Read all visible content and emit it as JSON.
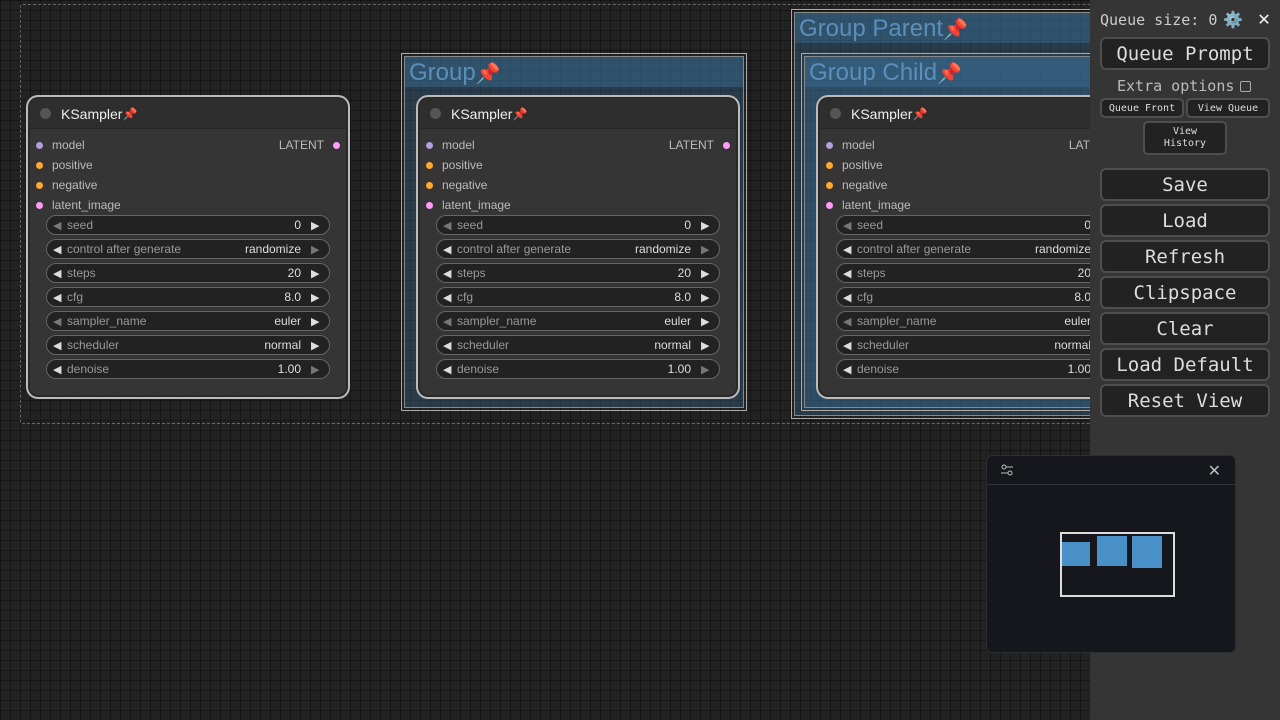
{
  "node_title": "KSampler",
  "pin": "📌",
  "inputs": [
    {
      "name": "model",
      "color": "#b39ddb"
    },
    {
      "name": "positive",
      "color": "#ffa931"
    },
    {
      "name": "negative",
      "color": "#ffa931"
    },
    {
      "name": "latent_image",
      "color": "#ff9cf9"
    }
  ],
  "output": "LATENT",
  "widgets": [
    {
      "name": "seed",
      "value": "0"
    },
    {
      "name": "control after generate",
      "value": "randomize"
    },
    {
      "name": "steps",
      "value": "20"
    },
    {
      "name": "cfg",
      "value": "8.0"
    },
    {
      "name": "sampler_name",
      "value": "euler"
    },
    {
      "name": "scheduler",
      "value": "normal"
    },
    {
      "name": "denoise",
      "value": "1.00"
    }
  ],
  "groups": {
    "group": "Group",
    "parent": "Group Parent",
    "child": "Group Child"
  },
  "sidebar": {
    "queue_size": "Queue size: 0",
    "queue_prompt": "Queue Prompt",
    "extra_options": "Extra options",
    "queue_front": "Queue Front",
    "view_queue": "View Queue",
    "view_history_line1": "View",
    "view_history_line2": "History",
    "save": "Save",
    "load": "Load",
    "refresh": "Refresh",
    "clipspace": "Clipspace",
    "clear": "Clear",
    "load_default": "Load Default",
    "reset_view": "Reset View"
  },
  "icons": {
    "gear": "⚙️",
    "close": "✕",
    "settings_sliders": "sliders-icon"
  }
}
